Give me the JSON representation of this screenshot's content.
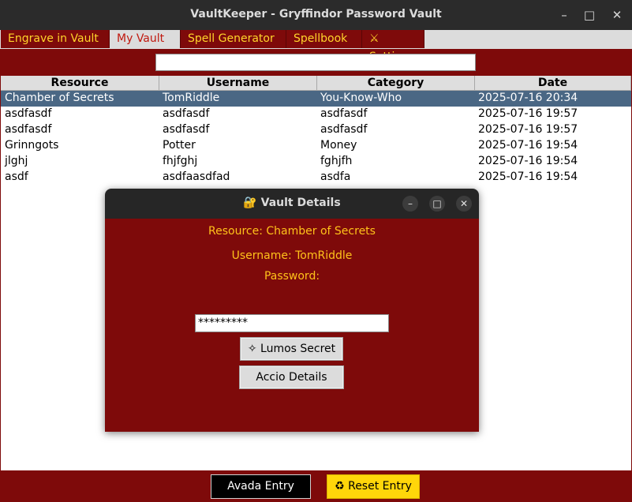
{
  "window": {
    "title": "VaultKeeper - Gryffindor Password Vault"
  },
  "tabs": [
    {
      "label": "Engrave in Vault"
    },
    {
      "label": "My Vault"
    },
    {
      "label": "Spell Generator"
    },
    {
      "label": "Spellbook"
    },
    {
      "label": "⚔ Settings"
    }
  ],
  "search": {
    "value": ""
  },
  "table": {
    "columns": [
      "Resource",
      "Username",
      "Category",
      "Date"
    ],
    "rows": [
      [
        "Chamber of Secrets",
        "TomRiddle",
        "You-Know-Who",
        "2025-07-16 20:34"
      ],
      [
        "asdfasdf",
        "asdfasdf",
        "asdfasdf",
        "2025-07-16 19:57"
      ],
      [
        "asdfasdf",
        "asdfasdf",
        "asdfasdf",
        "2025-07-16 19:57"
      ],
      [
        "Grinngots",
        "Potter",
        "Money",
        "2025-07-16 19:54"
      ],
      [
        "jlghj",
        "fhjfghj",
        "fghjfh",
        "2025-07-16 19:54"
      ],
      [
        "asdf",
        "asdfaasdfad",
        "asdfa",
        "2025-07-16 19:54"
      ]
    ]
  },
  "footer": {
    "delete_label": "Avada Entry",
    "reset_label": "♻ Reset Entry"
  },
  "dialog": {
    "title": "🔐 Vault Details",
    "resource": "Resource: Chamber of Secrets",
    "username": "Username: TomRiddle",
    "password_label": "Password:",
    "password_value": "*********",
    "reveal_label": "✧ Lumos Secret",
    "copy_label": "Accio Details"
  },
  "colors": {
    "crimson": "#7e0a0a",
    "gold": "#ffc21a",
    "selection": "#4a6784",
    "yellow": "#ffd60a"
  }
}
